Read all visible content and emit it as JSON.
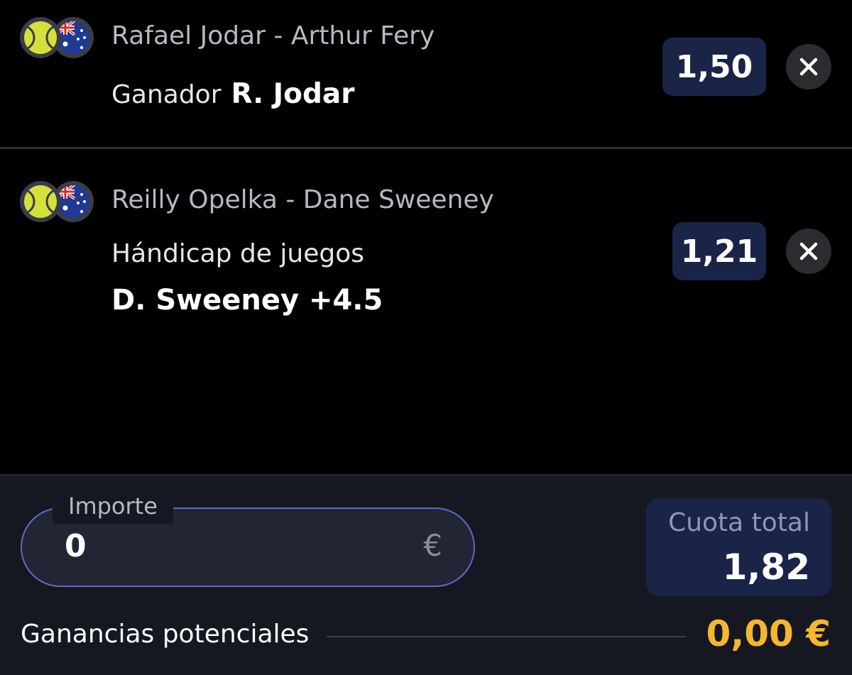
{
  "colors": {
    "background": "#000000",
    "odds_badge": "#1a2447",
    "footer": "#161821",
    "field_border": "#5a6ec4",
    "payout": "#f5b731"
  },
  "bets": [
    {
      "sport_icon": "tennis-ball-icon",
      "flag_icon": "australia-flag-icon",
      "match": "Rafael Jodar - Arthur Fery",
      "market": "Ganador",
      "selection": "R. Jodar",
      "odds": "1,50",
      "remove_icon": "close-icon"
    },
    {
      "sport_icon": "tennis-ball-icon",
      "flag_icon": "australia-flag-icon",
      "match": "Reilly Opelka - Dane Sweeney",
      "market": "Hándicap de juegos",
      "selection": "D. Sweeney +4.5",
      "odds": "1,21",
      "remove_icon": "close-icon"
    }
  ],
  "stake": {
    "label": "Importe",
    "value": "0",
    "currency": "€"
  },
  "total_odds": {
    "label": "Cuota total",
    "value": "1,82"
  },
  "potential_winnings": {
    "label": "Ganancias potenciales",
    "value": "0,00 €"
  }
}
